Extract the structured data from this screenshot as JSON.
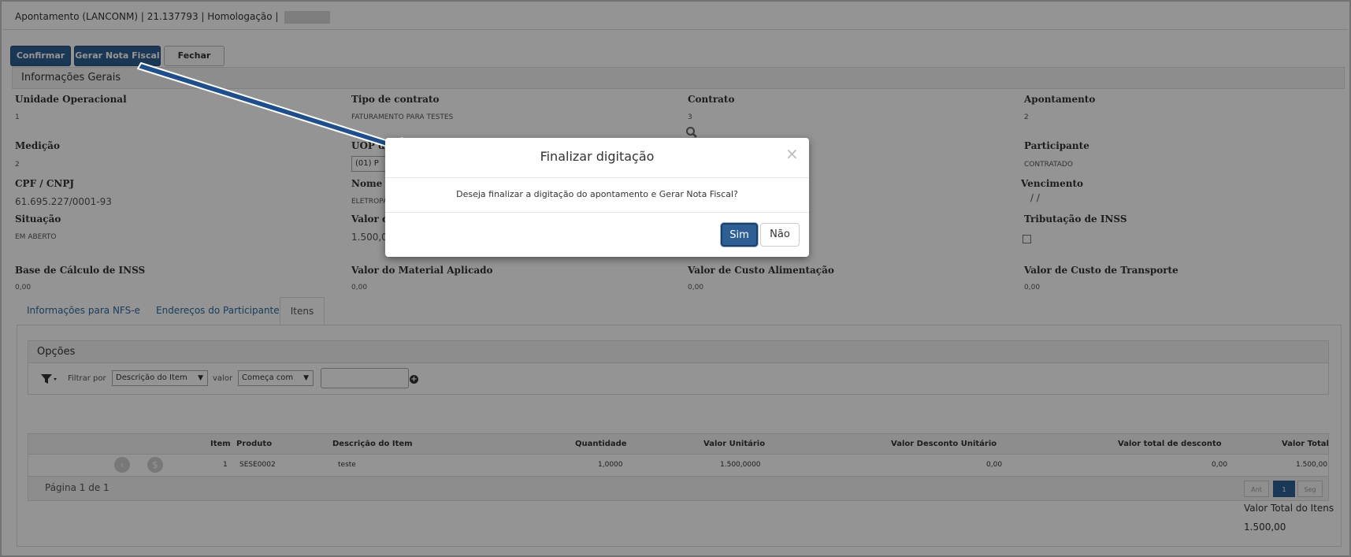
{
  "window": {
    "title": "Apontamento (LANCONM) | 21.137793 | Homologação |"
  },
  "toolbar": {
    "confirm_label": "Confirmar",
    "invoice_label": "Gerar Nota Fiscal",
    "close_label": "Fechar"
  },
  "section_title": "Informações Gerais",
  "fields": {
    "unidade_label": "Unidade Operacional",
    "unidade_value": "1",
    "tipo_contrato_label": "Tipo de contrato",
    "tipo_contrato_value": "FATURAMENTO PARA TESTES",
    "contrato_label": "Contrato",
    "contrato_value": "3",
    "apontamento_label": "Apontamento",
    "apontamento_value": "2",
    "medicao_label": "Medição",
    "medicao_value": "2",
    "uop_label": "UOP de",
    "uop_value": "(01) P",
    "participante_label": "Participante",
    "participante_value": "CONTRATADO",
    "cpf_label": "CPF / CNPJ",
    "cpf_value": "61.695.227/0001-93",
    "nome_label": "Nome /",
    "nome_value": "ELETROPA",
    "vencimento_label": "Vencimento",
    "vencimento_value": "/ /",
    "situacao_label": "Situação",
    "situacao_value": "EM ABERTO",
    "valor_do_label": "Valor do",
    "valor_do_value": "1.500,0",
    "trib_inss_label": "Tributação de INSS",
    "base_inss_label": "Base de Cálculo de INSS",
    "base_inss_value": "0,00",
    "material_label": "Valor do Material Aplicado",
    "material_value": "0,00",
    "alimentacao_label": "Valor de Custo Alimentação",
    "alimentacao_value": "0,00",
    "transporte_label": "Valor de Custo de Transporte",
    "transporte_value": "0,00"
  },
  "tabs": [
    {
      "label": "Informações para NFS-e"
    },
    {
      "label": "Endereços do Participante"
    },
    {
      "label": "Itens"
    }
  ],
  "options": {
    "title": "Opções",
    "filter_by_label": "Filtrar por",
    "filter_field": "Descrição do Item",
    "value_label": "valor",
    "operator": "Começa com",
    "filter_value": ""
  },
  "table": {
    "headers": [
      "Item",
      "Produto",
      "Descrição do Item",
      "Quantidade",
      "Valor Unitário",
      "Valor Desconto Unitário",
      "Valor total de desconto",
      "Valor Total"
    ],
    "rows": [
      [
        "1",
        "SESE0002",
        "teste",
        "1,0000",
        "1.500,0000",
        "0,00",
        "0,00",
        "1.500,00"
      ]
    ],
    "page_info": "Página 1 de 1",
    "pager": {
      "prev": "Ant",
      "current": "1",
      "next": "Seg"
    }
  },
  "totals": {
    "label": "Valor Total do Itens",
    "value": "1.500,00"
  },
  "modal": {
    "title": "Finalizar digitação",
    "close_glyph": "×",
    "message": "Deseja finalizar a digitação do apontamento e Gerar Nota Fiscal?",
    "yes_label": "Sim",
    "no_label": "Não"
  },
  "colors": {
    "primary": "#2e5f94",
    "link": "#2e6a9e",
    "arrow": "#1f4f8a"
  }
}
